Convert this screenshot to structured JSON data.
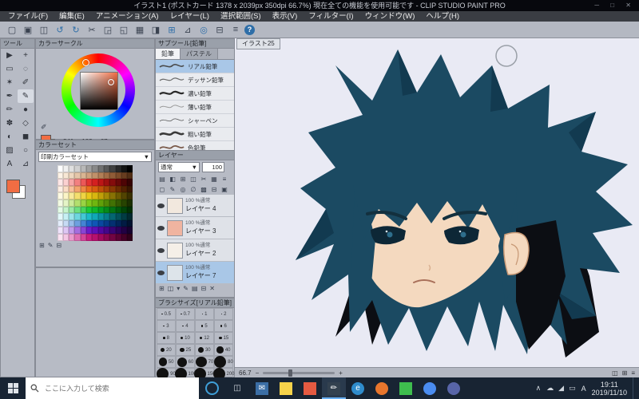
{
  "titlebar": {
    "title": "イラスト1 (ポストカード 1378 x 2039px 350dpi 66.7%) 現在全ての機能を使用可能です - CLIP STUDIO PAINT PRO",
    "controls": [
      "─",
      "□",
      "✕"
    ]
  },
  "menubar": {
    "items": [
      "ファイル(F)",
      "編集(E)",
      "アニメーション(A)",
      "レイヤー(L)",
      "選択範囲(S)",
      "表示(V)",
      "フィルター(I)",
      "ウィンドウ(W)",
      "ヘルプ(H)"
    ]
  },
  "toolbar": {
    "buttons": [
      {
        "name": "new-canvas-button",
        "glyph": "▢"
      },
      {
        "name": "open-file-button",
        "glyph": "▣"
      },
      {
        "name": "save-button",
        "glyph": "◫"
      },
      {
        "name": "undo-button",
        "glyph": "↺",
        "blue": true
      },
      {
        "name": "redo-button",
        "glyph": "↻",
        "blue": true
      },
      {
        "name": "cut-button",
        "glyph": "✂"
      },
      {
        "name": "copy-button",
        "glyph": "◲"
      },
      {
        "name": "paste-button",
        "glyph": "◱"
      },
      {
        "name": "deselect-button",
        "glyph": "▦"
      },
      {
        "name": "invert-selection-button",
        "glyph": "◨"
      },
      {
        "name": "show-grid-button",
        "glyph": "⊞",
        "blue": true
      },
      {
        "name": "snap-ruler-button",
        "glyph": "⊿"
      },
      {
        "name": "snap-special-ruler-button",
        "glyph": "◎",
        "blue": true
      },
      {
        "name": "snap-grid-button",
        "glyph": "⊟"
      },
      {
        "name": "workspace-settings-button",
        "glyph": "≡"
      },
      {
        "name": "help-button",
        "glyph": "?",
        "help": true
      }
    ]
  },
  "toolpanel": {
    "title": "ツール",
    "primary_color": "#f16d43",
    "secondary_color": "#ffffff",
    "tools": [
      {
        "name": "operate-tool",
        "glyph": "▶"
      },
      {
        "name": "layer-move-tool",
        "glyph": "+"
      },
      {
        "name": "selection-tool",
        "glyph": "▭"
      },
      {
        "name": "lasso-tool",
        "glyph": "◌"
      },
      {
        "name": "auto-select-tool",
        "glyph": "✶"
      },
      {
        "name": "eyedropper-tool",
        "glyph": "✐"
      },
      {
        "name": "pen-tool",
        "glyph": "✒"
      },
      {
        "name": "pencil-tool",
        "glyph": "✎",
        "selected": true
      },
      {
        "name": "brush-tool",
        "glyph": "✏"
      },
      {
        "name": "airbrush-tool",
        "glyph": "●"
      },
      {
        "name": "decoration-tool",
        "glyph": "✽"
      },
      {
        "name": "eraser-tool",
        "glyph": "◇"
      },
      {
        "name": "blend-tool",
        "glyph": "◐"
      },
      {
        "name": "fill-tool",
        "glyph": "◼"
      },
      {
        "name": "gradient-tool",
        "glyph": "▨"
      },
      {
        "name": "figure-tool",
        "glyph": "○"
      },
      {
        "name": "text-tool",
        "glyph": "A"
      },
      {
        "name": "ruler-tool",
        "glyph": "⊿"
      }
    ]
  },
  "colorwheel": {
    "title": "カラーサークル",
    "r": "241",
    "g": "109",
    "b": "67",
    "selected_hex": "#f16d43",
    "eyedropper_glyph": "✐"
  },
  "colorset": {
    "title": "カラーセット",
    "preset": "印刷カラーセット",
    "dropdown_arrow": "▼",
    "footer_icons": [
      {
        "name": "add-swatch-icon",
        "glyph": "⊞"
      },
      {
        "name": "edit-swatch-icon",
        "glyph": "✎"
      },
      {
        "name": "delete-swatch-icon",
        "glyph": "⊟"
      }
    ],
    "rows": [
      [
        "#ffffff",
        "#f0f0f0",
        "#e0e0e0",
        "#d0d0d0",
        "#b8b8b8",
        "#a0a0a0",
        "#888888",
        "#707070",
        "#585858",
        "#404040",
        "#282828",
        "#141414",
        "#000000"
      ],
      [
        "#fdf3e7",
        "#f7e7d4",
        "#eed7bf",
        "#e4c6a9",
        "#d9b593",
        "#cda37e",
        "#c0916a",
        "#b27f57",
        "#a26d46",
        "#905c37",
        "#7d4c2a",
        "#683d1f",
        "#522f16"
      ],
      [
        "#fde7e7",
        "#fbd0d0",
        "#f7a8a8",
        "#f28080",
        "#ec5858",
        "#e43232",
        "#d42020",
        "#bc1616",
        "#a01010",
        "#840c0c",
        "#680808",
        "#4e0505",
        "#360303"
      ],
      [
        "#fdeee3",
        "#fbdcc6",
        "#f8c09a",
        "#f4a46e",
        "#ef8844",
        "#e96c1c",
        "#d85d10",
        "#c05009",
        "#a44406",
        "#883804",
        "#6c2c02",
        "#522101",
        "#3a1701"
      ],
      [
        "#fdfae3",
        "#fbf4c6",
        "#f8ea9a",
        "#f4df6e",
        "#efd444",
        "#e9c81c",
        "#d8b610",
        "#c0a009",
        "#a48a06",
        "#887204",
        "#6c5a02",
        "#524401",
        "#3a3001"
      ],
      [
        "#f2fae3",
        "#e4f4c6",
        "#ccea9a",
        "#b3df6e",
        "#99d444",
        "#7fc81c",
        "#6fb610",
        "#60a009",
        "#518a06",
        "#427204",
        "#345a02",
        "#274401",
        "#1b3001"
      ],
      [
        "#e3fae6",
        "#c6f4cc",
        "#9aeaa6",
        "#6edf80",
        "#44d45c",
        "#1cc838",
        "#10b62c",
        "#09a022",
        "#068a1a",
        "#047213",
        "#025a0d",
        "#014408",
        "#013004"
      ],
      [
        "#e3f8fa",
        "#c6f0f4",
        "#9ae4ea",
        "#6ed6df",
        "#44c8d4",
        "#1cbac8",
        "#10a8b6",
        "#0992a0",
        "#067d8a",
        "#046672",
        "#02505a",
        "#013c44",
        "#012a30"
      ],
      [
        "#e3ecfa",
        "#c6daf4",
        "#9abeea",
        "#6ea0df",
        "#4484d4",
        "#1c66c8",
        "#1056b6",
        "#0948a0",
        "#063c8a",
        "#043072",
        "#02255a",
        "#011b44",
        "#011230"
      ],
      [
        "#efe3fa",
        "#dec6f4",
        "#c29aea",
        "#a56edf",
        "#8944d4",
        "#6c1cc8",
        "#5e10b6",
        "#5009a0",
        "#44068a",
        "#380472",
        "#2c025a",
        "#210144",
        "#170130"
      ],
      [
        "#fae3f2",
        "#f4c6e4",
        "#ea9acc",
        "#df6eb3",
        "#d44499",
        "#c81c7f",
        "#b6106f",
        "#a00960",
        "#8a0651",
        "#720442",
        "#5a0234",
        "#440127",
        "#30011b"
      ]
    ]
  },
  "subtool": {
    "title": "サブツール[鉛筆]",
    "tabs": [
      {
        "label": "鉛筆",
        "active": true
      },
      {
        "label": "パステル",
        "active": false
      }
    ],
    "brushes": [
      {
        "name": "リアル鉛筆",
        "stroke": "#4a4a4a",
        "w": 1.6,
        "selected": true
      },
      {
        "name": "デッサン鉛筆",
        "stroke": "#6a6a6a",
        "w": 1.2
      },
      {
        "name": "濃い鉛筆",
        "stroke": "#2a2a2a",
        "w": 2.2
      },
      {
        "name": "薄い鉛筆",
        "stroke": "#9a9a9a",
        "w": 1.0
      },
      {
        "name": "シャーペン",
        "stroke": "#555555",
        "w": 0.8
      },
      {
        "name": "粗い鉛筆",
        "stroke": "#3a3a3a",
        "w": 2.6
      },
      {
        "name": "色鉛筆",
        "stroke": "#7a5a4a",
        "w": 1.8
      }
    ]
  },
  "layers": {
    "title": "レイヤー",
    "blend_mode": "通常",
    "dropdown_arrow": "▼",
    "opacity": "100",
    "effect_icons_row1": [
      {
        "name": "palette-color-icon",
        "glyph": "▤"
      },
      {
        "name": "blend-icon",
        "glyph": "◧"
      },
      {
        "name": "divide-icon",
        "glyph": "⊞"
      },
      {
        "name": "combine-icon",
        "glyph": "◫"
      },
      {
        "name": "clip-icon",
        "glyph": "✂"
      },
      {
        "name": "reference-icon",
        "glyph": "▦"
      },
      {
        "name": "menu-icon",
        "glyph": "≡"
      }
    ],
    "effect_icons_row2": [
      {
        "name": "lock-icon",
        "glyph": "◻"
      },
      {
        "name": "lock-pixel-icon",
        "glyph": "✎"
      },
      {
        "name": "mask-icon",
        "glyph": "◎"
      },
      {
        "name": "draft-icon",
        "glyph": "∅"
      },
      {
        "name": "texture-icon",
        "glyph": "▩"
      },
      {
        "name": "subtract-icon",
        "glyph": "⊟"
      },
      {
        "name": "set-icon",
        "glyph": "▣"
      }
    ],
    "items": [
      {
        "info": "100 %通常",
        "name": "レイヤー 4",
        "thumb": "#f2e8de",
        "selected": false
      },
      {
        "info": "100 %通常",
        "name": "レイヤー 3",
        "thumb": "#f0b4a0",
        "selected": false
      },
      {
        "info": "100 %通常",
        "name": "レイヤー 2",
        "thumb": "#f5efe8",
        "selected": false
      },
      {
        "info": "100 %通常",
        "name": "レイヤー 7",
        "thumb": "#dde4ea",
        "selected": true
      }
    ],
    "footer_icons": [
      {
        "name": "new-layer-icon",
        "glyph": "⊞"
      },
      {
        "name": "new-folder-icon",
        "glyph": "◫"
      },
      {
        "name": "transfer-icon",
        "glyph": "▾"
      },
      {
        "name": "merge-icon",
        "glyph": "✎"
      },
      {
        "name": "mask-add-icon",
        "glyph": "▤"
      },
      {
        "name": "apply-icon",
        "glyph": "⊟"
      },
      {
        "name": "delete-layer-icon",
        "glyph": "✕"
      }
    ]
  },
  "brushsize": {
    "title": "ブラシサイズ[リアル鉛筆]",
    "rows": [
      [
        "0.5",
        "0.7",
        "1",
        "2"
      ],
      [
        "3",
        "4",
        "5",
        "6"
      ],
      [
        "8",
        "10",
        "12",
        "15"
      ],
      [
        "20",
        "25",
        "30",
        "40"
      ],
      [
        "50",
        "60",
        "70",
        "80"
      ],
      [
        "90",
        "100",
        "150",
        "200"
      ]
    ]
  },
  "canvas": {
    "tab": "イラスト25"
  },
  "artwork": {
    "background": "#e9eaf4",
    "hair_main": "#1b4a62",
    "hair_dark": "#123a50",
    "hair_black": "#0c0e13",
    "skin": "#f4d9bf",
    "eye": "#0d2736",
    "iris": "#2e6e8c",
    "brow": "#13303e",
    "mouth": "#a9705a"
  },
  "statusbar": {
    "zoom": "66.7",
    "zoom_out_glyph": "−",
    "zoom_in_glyph": "+",
    "right_icons": [
      {
        "name": "navigator-icon",
        "glyph": "◫"
      },
      {
        "name": "grid-toggle-icon",
        "glyph": "⊞"
      },
      {
        "name": "status-menu-icon",
        "glyph": "≡"
      }
    ]
  },
  "taskbar": {
    "search_placeholder": "ここに入力して検索",
    "apps": [
      {
        "name": "mail-app",
        "color": "#3b6ea5",
        "glyph": "✉",
        "round": false,
        "active": false
      },
      {
        "name": "file-explorer",
        "color": "#f6d24a",
        "glyph": "",
        "round": false,
        "active": false
      },
      {
        "name": "clip-studio-app",
        "color": "#e55a41",
        "glyph": "",
        "round": false,
        "active": false
      },
      {
        "name": "clip-studio-paint",
        "color": "#33414f",
        "glyph": "✏",
        "round": false,
        "active": true
      },
      {
        "name": "edge-browser",
        "color": "#2f8ccc",
        "glyph": "e",
        "round": true,
        "active": false
      },
      {
        "name": "firefox-browser",
        "color": "#e8762d",
        "glyph": "",
        "round": true,
        "active": false
      },
      {
        "name": "line-app",
        "color": "#3ebd4e",
        "glyph": "",
        "round": false,
        "active": false
      },
      {
        "name": "chrome-browser",
        "color": "#4a8cf0",
        "glyph": "",
        "round": true,
        "active": false
      },
      {
        "name": "discord-app",
        "color": "#5865a8",
        "glyph": "",
        "round": true,
        "active": false
      }
    ],
    "tray": {
      "expand_glyph": "∧",
      "icons": [
        {
          "name": "onedrive-icon",
          "glyph": "☁"
        },
        {
          "name": "network-icon",
          "glyph": "◢"
        },
        {
          "name": "battery-icon",
          "glyph": "▭"
        }
      ],
      "ime": "A",
      "time": "19:11",
      "date": "2019/11/10"
    }
  }
}
